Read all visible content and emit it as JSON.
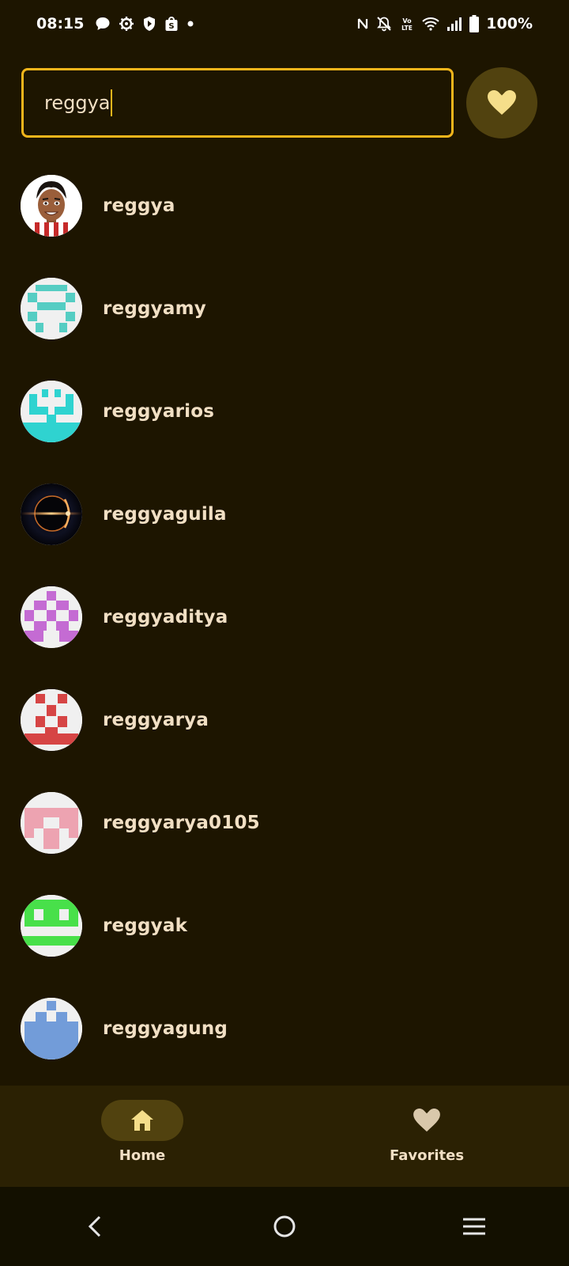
{
  "status_bar": {
    "time": "08:15",
    "battery": "100%",
    "left_icons": [
      "message-icon",
      "gear-icon",
      "shield-icon",
      "shopping-bag-icon",
      "dot-icon"
    ],
    "right_icons": [
      "nfc-icon",
      "bell-off-icon",
      "volte-icon",
      "wifi-icon",
      "signal-icon",
      "battery-icon"
    ]
  },
  "search": {
    "value": "reggya",
    "accent": "#f2b51b"
  },
  "favorite_fab": {
    "icon": "heart-icon",
    "background": "#51420f",
    "icon_color": "#f5de8a"
  },
  "results": [
    {
      "username": "reggya",
      "avatar": "cartoon-avatar"
    },
    {
      "username": "reggyamy",
      "avatar": "identicon-teal"
    },
    {
      "username": "reggyarios",
      "avatar": "identicon-cyan"
    },
    {
      "username": "reggyaguila",
      "avatar": "eclipse-photo"
    },
    {
      "username": "reggyaditya",
      "avatar": "identicon-purple"
    },
    {
      "username": "reggyarya",
      "avatar": "identicon-red"
    },
    {
      "username": "reggyarya0105",
      "avatar": "identicon-pink"
    },
    {
      "username": "reggyak",
      "avatar": "identicon-green"
    },
    {
      "username": "reggyagung",
      "avatar": "identicon-blue"
    }
  ],
  "bottom_nav": {
    "home_label": "Home",
    "favorites_label": "Favorites",
    "active": "home"
  },
  "colors": {
    "background": "#1d1500",
    "text": "#f1dfc4",
    "nav_background": "#2b2103",
    "active_indicator": "#51420f"
  }
}
